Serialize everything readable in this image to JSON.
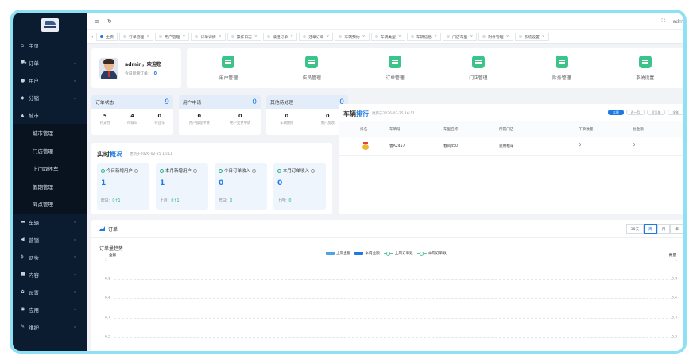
{
  "sidebar": {
    "items": [
      {
        "icon": "home-icon",
        "glyph": "⌂",
        "label": "主页",
        "chevron": false
      },
      {
        "icon": "cart-icon",
        "glyph": "⛟",
        "label": "订单",
        "chevron": true
      },
      {
        "icon": "user-icon",
        "glyph": "●",
        "label": "用户",
        "chevron": true
      },
      {
        "icon": "share-icon",
        "glyph": "◆",
        "label": "分销",
        "chevron": true
      },
      {
        "icon": "city-icon",
        "glyph": "▲",
        "label": "城市",
        "chevron": true,
        "expanded": true
      }
    ],
    "sub_items": [
      "城市管理",
      "门店管理",
      "上门取还车",
      "假期管理",
      "网点管理"
    ],
    "items_after": [
      {
        "icon": "car-icon",
        "glyph": "▬",
        "label": "车辆",
        "chevron": true
      },
      {
        "icon": "marketing-icon",
        "glyph": "◀",
        "label": "营销",
        "chevron": true
      },
      {
        "icon": "finance-icon",
        "glyph": "$",
        "label": "财务",
        "chevron": true
      },
      {
        "icon": "content-icon",
        "glyph": "■",
        "label": "内容",
        "chevron": true
      },
      {
        "icon": "settings-icon",
        "glyph": "✿",
        "label": "设置",
        "chevron": true
      },
      {
        "icon": "app-icon",
        "glyph": "◉",
        "label": "应用",
        "chevron": true
      },
      {
        "icon": "maintain-icon",
        "glyph": "✎",
        "label": "维护",
        "chevron": true
      }
    ]
  },
  "topbar": {
    "menu_icon": "≡",
    "refresh_icon": "↻",
    "fullscreen_icon": "⛶",
    "user": "adm"
  },
  "tabs": [
    "主页",
    "订单管理",
    "用户管理",
    "订单详情",
    "操作日志",
    "续租订单",
    "违章订单",
    "车辆预约",
    "车辆类型",
    "车辆信息",
    "门店车型",
    "附件管理",
    "系统设置"
  ],
  "welcome": {
    "greeting": "admin，欢迎您",
    "today_label": "今日新增订单：",
    "today_value": "0"
  },
  "shortcuts": [
    {
      "icon": "user-manage-icon",
      "label": "用户管理"
    },
    {
      "icon": "clerk-manage-icon",
      "label": "店员管理"
    },
    {
      "icon": "order-manage-icon",
      "label": "订单管理"
    },
    {
      "icon": "store-manage-icon",
      "label": "门店管理"
    },
    {
      "icon": "finance-manage-icon",
      "label": "财务管理"
    },
    {
      "icon": "system-settings-icon",
      "label": "系统设置"
    }
  ],
  "stats": [
    {
      "title": "订单状态",
      "total": "9",
      "items": [
        {
          "n": "5",
          "l": "待支付"
        },
        {
          "n": "4",
          "l": "待取车"
        },
        {
          "n": "0",
          "l": "待还车"
        }
      ]
    },
    {
      "title": "用户申请",
      "total": "0",
      "items": [
        {
          "n": "0",
          "l": "用户提现申请"
        },
        {
          "n": "0",
          "l": "用户变更申请"
        }
      ]
    },
    {
      "title": "其他待处理",
      "total": "0",
      "items": [
        {
          "n": "0",
          "l": "车辆预约"
        },
        {
          "n": "0",
          "l": "用户反馈"
        }
      ]
    }
  ],
  "realtime": {
    "title_a": "实时",
    "title_b": "概况",
    "updated": "更新于2026-02-25 16:11",
    "boxes": [
      {
        "title": "今日新增用户",
        "value": "1",
        "foot_label": "昨日：",
        "foot_value": "0↑1"
      },
      {
        "title": "本月新增用户",
        "value": "1",
        "foot_label": "上月：",
        "foot_value": "0↑1"
      },
      {
        "title": "今日订单收入",
        "value": "0",
        "foot_label": "昨日：",
        "foot_value": "0"
      },
      {
        "title": "本月订单收入",
        "value": "0",
        "foot_label": "上月：",
        "foot_value": "0"
      }
    ]
  },
  "ranking": {
    "title_a": "车辆",
    "title_b": "排行",
    "updated": "更新于2026-02-25 16:11",
    "ranges": [
      "本周",
      "近一月",
      "近半年",
      "全年"
    ],
    "active_range": 0,
    "columns": [
      "排名",
      "车牌号",
      "车型名称",
      "所属门店",
      "下单数量",
      "总金额"
    ],
    "rows": [
      {
        "rank_icon": "gold-medal-icon",
        "plate": "鲁A2457",
        "model": "春风450",
        "store": "速用租车",
        "count": "0",
        "amount": "0"
      }
    ]
  },
  "order_panel": {
    "title": "订单",
    "ranges": [
      "30天",
      "周",
      "月",
      "年"
    ],
    "active_range": 1,
    "chart_title": "订单量趋势",
    "y_left_label": "金额",
    "y_right_label": "数量"
  },
  "colors": {
    "accent": "#1e7ae3",
    "sidebar_bg": "#0c1c30",
    "green": "#3cc38a"
  },
  "chart_data": {
    "type": "line",
    "title": "订单量趋势",
    "ylabel_left": "金额",
    "ylabel_right": "数量",
    "series": [
      {
        "name": "上周金额",
        "kind": "bar",
        "color": "#4ea3e6",
        "values": []
      },
      {
        "name": "本周金额",
        "kind": "bar",
        "color": "#1e7ae3",
        "values": []
      },
      {
        "name": "上周订单数",
        "kind": "line",
        "color": "#5ec6a0",
        "values": []
      },
      {
        "name": "本周订单数",
        "kind": "line",
        "color": "#5ec6a0",
        "values": []
      }
    ],
    "y_ticks_left": [
      "1",
      "0.8",
      "0.6",
      "0.4",
      "0.2"
    ],
    "y_ticks_right": [
      "1",
      "0.8",
      "0.6",
      "0.4",
      "0.2"
    ],
    "ylim": [
      0,
      1
    ],
    "legend": "top-center",
    "grid": true
  }
}
